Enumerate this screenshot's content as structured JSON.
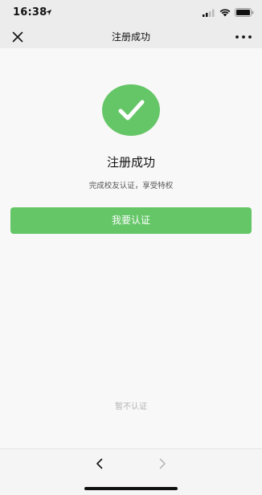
{
  "status_bar": {
    "time": "16:38"
  },
  "nav": {
    "title": "注册成功",
    "close_icon": "close-icon",
    "more_icon": "more-icon"
  },
  "result": {
    "icon": "checkmark-icon",
    "title": "注册成功",
    "description": "完成校友认证，享受特权"
  },
  "actions": {
    "primary_label": "我要认证",
    "skip_label": "暂不认证"
  },
  "toolbar": {
    "back_icon": "chevron-left-icon",
    "forward_icon": "chevron-right-icon"
  },
  "colors": {
    "accent": "#65c667",
    "background": "#f8f8f8",
    "bar": "#ececec"
  }
}
